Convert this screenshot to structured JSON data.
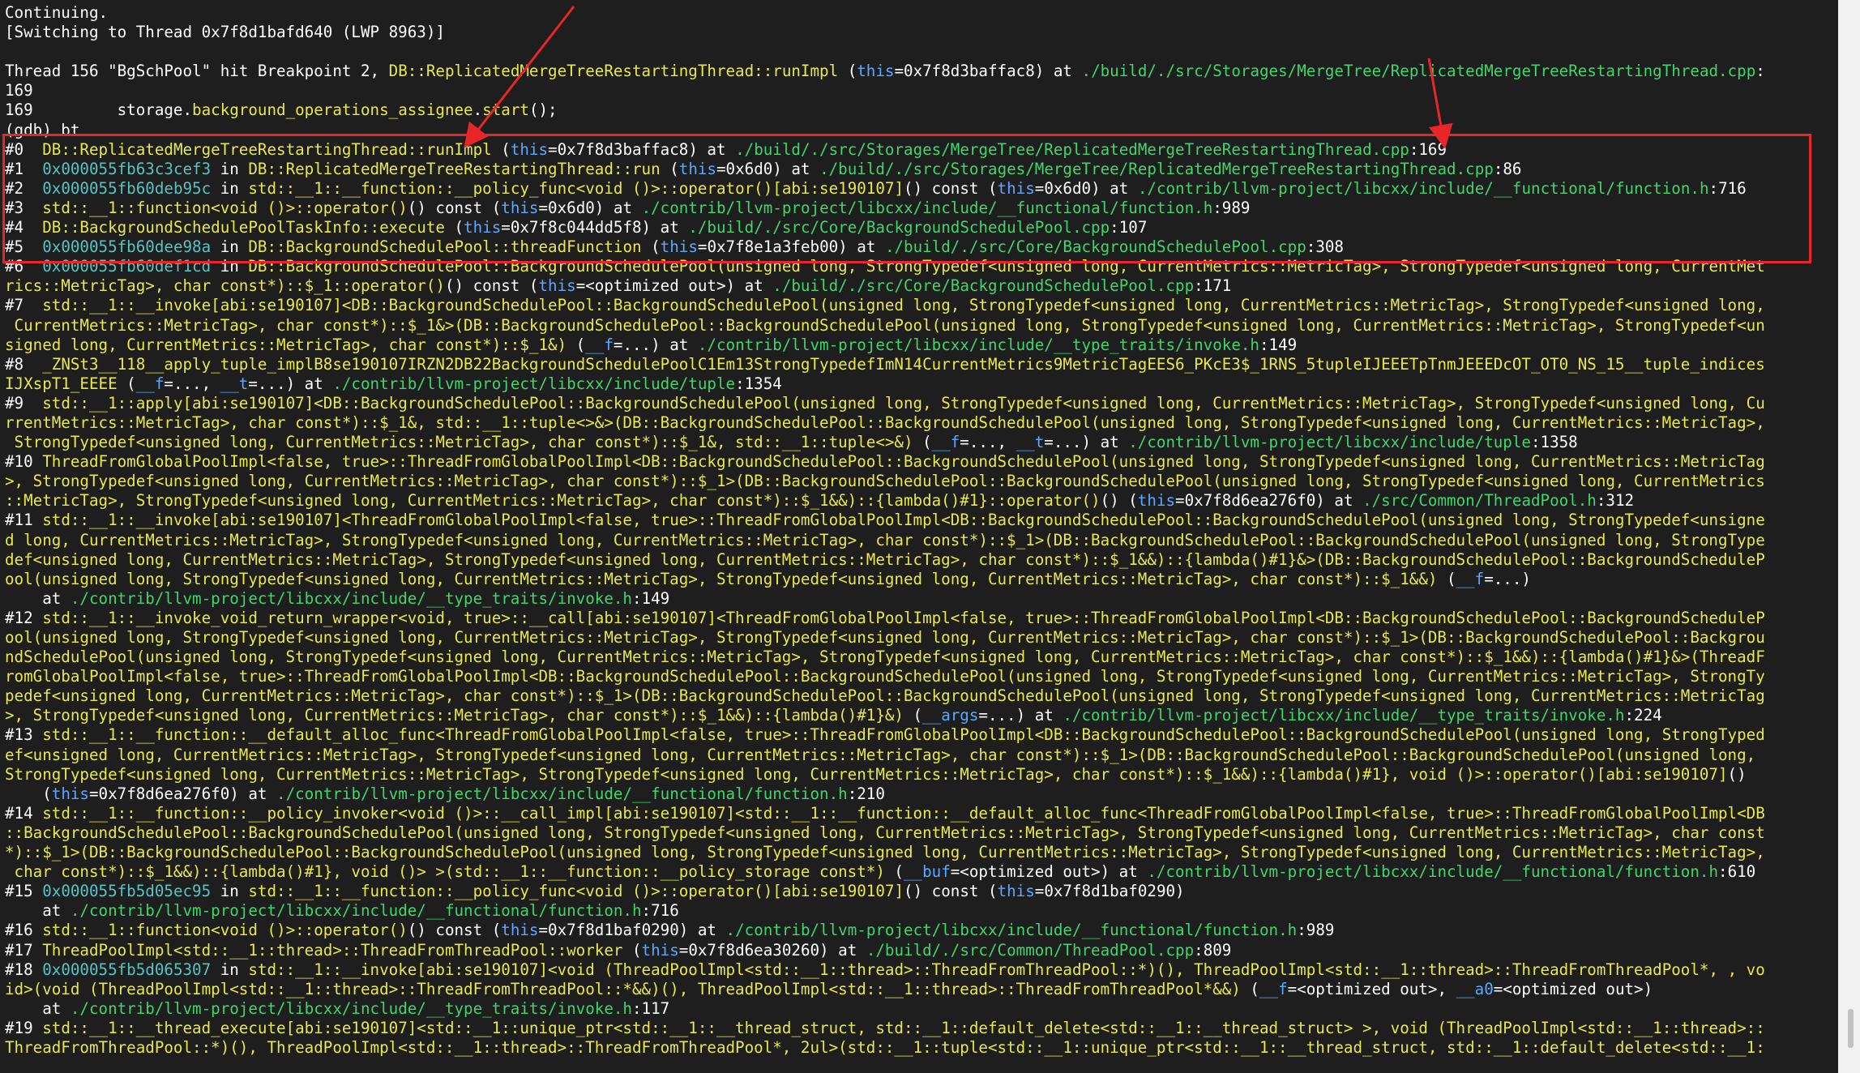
{
  "colors": {
    "background": "#1e1e1e",
    "highlight": "#e8262a",
    "text": "#ffffff",
    "function": "#e8e84a",
    "address": "#56c4c4",
    "path": "#3fd66b",
    "keyword": "#5aa8ff"
  },
  "lines": [
    [
      [
        "w",
        "Continuing."
      ]
    ],
    [
      [
        "w",
        "[Switching to Thread 0x7f8d1bafd640 (LWP 8963)]"
      ]
    ],
    [
      [
        "w",
        ""
      ]
    ],
    [
      [
        "w",
        "Thread 156 \"BgSchPool\" hit Breakpoint 2, "
      ],
      [
        "y",
        "DB::ReplicatedMergeTreeRestartingThread::runImpl"
      ],
      [
        "w",
        " ("
      ],
      [
        "b",
        "this"
      ],
      [
        "w",
        "=0x7f8d3baffac8) at "
      ],
      [
        "g",
        "./build/./src/Storages/MergeTree/ReplicatedMergeTreeRestartingThread.cpp"
      ],
      [
        "w",
        ":"
      ]
    ],
    [
      [
        "w",
        "169"
      ]
    ],
    [
      [
        "w",
        "169         storage."
      ],
      [
        "y",
        "background_operations_assignee"
      ],
      [
        "w",
        "."
      ],
      [
        "y",
        "start"
      ],
      [
        "w",
        "();"
      ]
    ],
    [
      [
        "w",
        "(gdb) bt"
      ]
    ],
    [
      [
        "w",
        "#0  "
      ],
      [
        "y",
        "DB::ReplicatedMergeTreeRestartingThread::runImpl"
      ],
      [
        "w",
        " ("
      ],
      [
        "b",
        "this"
      ],
      [
        "w",
        "=0x7f8d3baffac8) at "
      ],
      [
        "g",
        "./build/./src/Storages/MergeTree/ReplicatedMergeTreeRestartingThread.cpp"
      ],
      [
        "w",
        ":169"
      ]
    ],
    [
      [
        "w",
        "#1  "
      ],
      [
        "c",
        "0x000055fb63c3cef3"
      ],
      [
        "w",
        " in "
      ],
      [
        "y",
        "DB::ReplicatedMergeTreeRestartingThread::run"
      ],
      [
        "w",
        " ("
      ],
      [
        "b",
        "this"
      ],
      [
        "w",
        "=0x6d0) at "
      ],
      [
        "g",
        "./build/./src/Storages/MergeTree/ReplicatedMergeTreeRestartingThread.cpp"
      ],
      [
        "w",
        ":86"
      ]
    ],
    [
      [
        "w",
        "#2  "
      ],
      [
        "c",
        "0x000055fb60deb95c"
      ],
      [
        "w",
        " in "
      ],
      [
        "y",
        "std::__1::__function::__policy_func<void ()>::operator()[abi:se190107]"
      ],
      [
        "w",
        "() const ("
      ],
      [
        "b",
        "this"
      ],
      [
        "w",
        "=0x6d0) at "
      ],
      [
        "g",
        "./contrib/llvm-project/libcxx/include/__functional/function.h"
      ],
      [
        "w",
        ":716"
      ]
    ],
    [
      [
        "w",
        "#3  "
      ],
      [
        "y",
        "std::__1::function<void ()>::operator()"
      ],
      [
        "w",
        "() const ("
      ],
      [
        "b",
        "this"
      ],
      [
        "w",
        "=0x6d0) at "
      ],
      [
        "g",
        "./contrib/llvm-project/libcxx/include/__functional/function.h"
      ],
      [
        "w",
        ":989"
      ]
    ],
    [
      [
        "w",
        "#4  "
      ],
      [
        "y",
        "DB::BackgroundSchedulePoolTaskInfo::execute"
      ],
      [
        "w",
        " ("
      ],
      [
        "b",
        "this"
      ],
      [
        "w",
        "=0x7f8c044dd5f8) at "
      ],
      [
        "g",
        "./build/./src/Core/BackgroundSchedulePool.cpp"
      ],
      [
        "w",
        ":107"
      ]
    ],
    [
      [
        "w",
        "#5  "
      ],
      [
        "c",
        "0x000055fb60dee98a"
      ],
      [
        "w",
        " in "
      ],
      [
        "y",
        "DB::BackgroundSchedulePool::threadFunction"
      ],
      [
        "w",
        " ("
      ],
      [
        "b",
        "this"
      ],
      [
        "w",
        "=0x7f8e1a3feb00) at "
      ],
      [
        "g",
        "./build/./src/Core/BackgroundSchedulePool.cpp"
      ],
      [
        "w",
        ":308"
      ]
    ],
    [
      [
        "w",
        "#6  "
      ],
      [
        "c",
        "0x000055fb60def1cd"
      ],
      [
        "w",
        " in "
      ],
      [
        "y",
        "DB::BackgroundSchedulePool::BackgroundSchedulePool(unsigned long, StrongTypedef<unsigned long, CurrentMetrics::MetricTag>, StrongTypedef<unsigned long, CurrentMet"
      ]
    ],
    [
      [
        "y",
        "rics::MetricTag>, char const*)::$_1::operator()"
      ],
      [
        "w",
        "() const ("
      ],
      [
        "b",
        "this"
      ],
      [
        "w",
        "=<optimized out>) at "
      ],
      [
        "g",
        "./build/./src/Core/BackgroundSchedulePool.cpp"
      ],
      [
        "w",
        ":171"
      ]
    ],
    [
      [
        "w",
        "#7  "
      ],
      [
        "y",
        "std::__1::__invoke[abi:se190107]<DB::BackgroundSchedulePool::BackgroundSchedulePool(unsigned long, StrongTypedef<unsigned long, CurrentMetrics::MetricTag>, StrongTypedef<unsigned long,"
      ]
    ],
    [
      [
        "y",
        " CurrentMetrics::MetricTag>, char const*)::$_1&>(DB::BackgroundSchedulePool::BackgroundSchedulePool(unsigned long, StrongTypedef<unsigned long, CurrentMetrics::MetricTag>, StrongTypedef<un"
      ]
    ],
    [
      [
        "y",
        "signed long, CurrentMetrics::MetricTag>, char const*)::$_1&)"
      ],
      [
        "w",
        " ("
      ],
      [
        "b",
        "__f"
      ],
      [
        "w",
        "=...) at "
      ],
      [
        "g",
        "./contrib/llvm-project/libcxx/include/__type_traits/invoke.h"
      ],
      [
        "w",
        ":149"
      ]
    ],
    [
      [
        "w",
        "#8  "
      ],
      [
        "y",
        "_ZNSt3__118__apply_tuple_implB8se190107IRZN2DB22BackgroundSchedulePoolC1Em13StrongTypedefImN14CurrentMetrics9MetricTagEES6_PKcE3$_1RNS_5tupleIJEEETpTnmJEEEDcOT_OT0_NS_15__tuple_indices"
      ]
    ],
    [
      [
        "y",
        "IJXspT1_EEEE"
      ],
      [
        "w",
        " ("
      ],
      [
        "b",
        "__f"
      ],
      [
        "w",
        "=..., "
      ],
      [
        "b",
        "__t"
      ],
      [
        "w",
        "=...) at "
      ],
      [
        "g",
        "./contrib/llvm-project/libcxx/include/tuple"
      ],
      [
        "w",
        ":1354"
      ]
    ],
    [
      [
        "w",
        "#9  "
      ],
      [
        "y",
        "std::__1::apply[abi:se190107]<DB::BackgroundSchedulePool::BackgroundSchedulePool(unsigned long, StrongTypedef<unsigned long, CurrentMetrics::MetricTag>, StrongTypedef<unsigned long, Cu"
      ]
    ],
    [
      [
        "y",
        "rrentMetrics::MetricTag>, char const*)::$_1&, std::__1::tuple<>&>(DB::BackgroundSchedulePool::BackgroundSchedulePool(unsigned long, StrongTypedef<unsigned long, CurrentMetrics::MetricTag>,"
      ]
    ],
    [
      [
        "y",
        " StrongTypedef<unsigned long, CurrentMetrics::MetricTag>, char const*)::$_1&, std::__1::tuple<>&)"
      ],
      [
        "w",
        " ("
      ],
      [
        "b",
        "__f"
      ],
      [
        "w",
        "=..., "
      ],
      [
        "b",
        "__t"
      ],
      [
        "w",
        "=...) at "
      ],
      [
        "g",
        "./contrib/llvm-project/libcxx/include/tuple"
      ],
      [
        "w",
        ":1358"
      ]
    ],
    [
      [
        "w",
        "#10 "
      ],
      [
        "y",
        "ThreadFromGlobalPoolImpl<false, true>::ThreadFromGlobalPoolImpl<DB::BackgroundSchedulePool::BackgroundSchedulePool(unsigned long, StrongTypedef<unsigned long, CurrentMetrics::MetricTag"
      ]
    ],
    [
      [
        "y",
        ">, StrongTypedef<unsigned long, CurrentMetrics::MetricTag>, char const*)::$_1>(DB::BackgroundSchedulePool::BackgroundSchedulePool(unsigned long, StrongTypedef<unsigned long, CurrentMetrics"
      ]
    ],
    [
      [
        "y",
        "::MetricTag>, StrongTypedef<unsigned long, CurrentMetrics::MetricTag>, char const*)::$_1&&)::{lambda()#1}::operator()"
      ],
      [
        "w",
        "() ("
      ],
      [
        "b",
        "this"
      ],
      [
        "w",
        "=0x7f8d6ea276f0) at "
      ],
      [
        "g",
        "./src/Common/ThreadPool.h"
      ],
      [
        "w",
        ":312"
      ]
    ],
    [
      [
        "w",
        "#11 "
      ],
      [
        "y",
        "std::__1::__invoke[abi:se190107]<ThreadFromGlobalPoolImpl<false, true>::ThreadFromGlobalPoolImpl<DB::BackgroundSchedulePool::BackgroundSchedulePool(unsigned long, StrongTypedef<unsigne"
      ]
    ],
    [
      [
        "y",
        "d long, CurrentMetrics::MetricTag>, StrongTypedef<unsigned long, CurrentMetrics::MetricTag>, char const*)::$_1>(DB::BackgroundSchedulePool::BackgroundSchedulePool(unsigned long, StrongType"
      ]
    ],
    [
      [
        "y",
        "def<unsigned long, CurrentMetrics::MetricTag>, StrongTypedef<unsigned long, CurrentMetrics::MetricTag>, char const*)::$_1&&)::{lambda()#1}&>(DB::BackgroundSchedulePool::BackgroundScheduleP"
      ]
    ],
    [
      [
        "y",
        "ool(unsigned long, StrongTypedef<unsigned long, CurrentMetrics::MetricTag>, StrongTypedef<unsigned long, CurrentMetrics::MetricTag>, char const*)::$_1&&)"
      ],
      [
        "w",
        " ("
      ],
      [
        "b",
        "__f"
      ],
      [
        "w",
        "=...)"
      ]
    ],
    [
      [
        "w",
        "    at "
      ],
      [
        "g",
        "./contrib/llvm-project/libcxx/include/__type_traits/invoke.h"
      ],
      [
        "w",
        ":149"
      ]
    ],
    [
      [
        "w",
        "#12 "
      ],
      [
        "y",
        "std::__1::__invoke_void_return_wrapper<void, true>::__call[abi:se190107]<ThreadFromGlobalPoolImpl<false, true>::ThreadFromGlobalPoolImpl<DB::BackgroundSchedulePool::BackgroundScheduleP"
      ]
    ],
    [
      [
        "y",
        "ool(unsigned long, StrongTypedef<unsigned long, CurrentMetrics::MetricTag>, StrongTypedef<unsigned long, CurrentMetrics::MetricTag>, char const*)::$_1>(DB::BackgroundSchedulePool::Backgrou"
      ]
    ],
    [
      [
        "y",
        "ndSchedulePool(unsigned long, StrongTypedef<unsigned long, CurrentMetrics::MetricTag>, StrongTypedef<unsigned long, CurrentMetrics::MetricTag>, char const*)::$_1&&)::{lambda()#1}&>(ThreadF"
      ]
    ],
    [
      [
        "y",
        "romGlobalPoolImpl<false, true>::ThreadFromGlobalPoolImpl<DB::BackgroundSchedulePool::BackgroundSchedulePool(unsigned long, StrongTypedef<unsigned long, CurrentMetrics::MetricTag>, StrongTy"
      ]
    ],
    [
      [
        "y",
        "pedef<unsigned long, CurrentMetrics::MetricTag>, char const*)::$_1>(DB::BackgroundSchedulePool::BackgroundSchedulePool(unsigned long, StrongTypedef<unsigned long, CurrentMetrics::MetricTag"
      ]
    ],
    [
      [
        "y",
        ">, StrongTypedef<unsigned long, CurrentMetrics::MetricTag>, char const*)::$_1&&)::{lambda()#1}&)"
      ],
      [
        "w",
        " ("
      ],
      [
        "b",
        "__args"
      ],
      [
        "w",
        "=...) at "
      ],
      [
        "g",
        "./contrib/llvm-project/libcxx/include/__type_traits/invoke.h"
      ],
      [
        "w",
        ":224"
      ]
    ],
    [
      [
        "w",
        "#13 "
      ],
      [
        "y",
        "std::__1::__function::__default_alloc_func<ThreadFromGlobalPoolImpl<false, true>::ThreadFromGlobalPoolImpl<DB::BackgroundSchedulePool::BackgroundSchedulePool(unsigned long, StrongTyped"
      ]
    ],
    [
      [
        "y",
        "ef<unsigned long, CurrentMetrics::MetricTag>, StrongTypedef<unsigned long, CurrentMetrics::MetricTag>, char const*)::$_1>(DB::BackgroundSchedulePool::BackgroundSchedulePool(unsigned long,"
      ]
    ],
    [
      [
        "y",
        "StrongTypedef<unsigned long, CurrentMetrics::MetricTag>, StrongTypedef<unsigned long, CurrentMetrics::MetricTag>, char const*)::$_1&&)::{lambda()#1}, void ()>::operator()[abi:se190107]"
      ],
      [
        "w",
        "()"
      ]
    ],
    [
      [
        "w",
        "    ("
      ],
      [
        "b",
        "this"
      ],
      [
        "w",
        "=0x7f8d6ea276f0) at "
      ],
      [
        "g",
        "./contrib/llvm-project/libcxx/include/__functional/function.h"
      ],
      [
        "w",
        ":210"
      ]
    ],
    [
      [
        "w",
        "#14 "
      ],
      [
        "y",
        "std::__1::__function::__policy_invoker<void ()>::__call_impl[abi:se190107]<std::__1::__function::__default_alloc_func<ThreadFromGlobalPoolImpl<false, true>::ThreadFromGlobalPoolImpl<DB"
      ]
    ],
    [
      [
        "y",
        "::BackgroundSchedulePool::BackgroundSchedulePool(unsigned long, StrongTypedef<unsigned long, CurrentMetrics::MetricTag>, StrongTypedef<unsigned long, CurrentMetrics::MetricTag>, char const"
      ]
    ],
    [
      [
        "y",
        "*)::$_1>(DB::BackgroundSchedulePool::BackgroundSchedulePool(unsigned long, StrongTypedef<unsigned long, CurrentMetrics::MetricTag>, StrongTypedef<unsigned long, CurrentMetrics::MetricTag>,"
      ]
    ],
    [
      [
        "y",
        " char const*)::$_1&&)::{lambda()#1}, void ()> >(std::__1::__function::__policy_storage const*)"
      ],
      [
        "w",
        " ("
      ],
      [
        "b",
        "__buf"
      ],
      [
        "w",
        "=<optimized out>) at "
      ],
      [
        "g",
        "./contrib/llvm-project/libcxx/include/__functional/function.h"
      ],
      [
        "w",
        ":610"
      ]
    ],
    [
      [
        "w",
        "#15 "
      ],
      [
        "c",
        "0x000055fb5d05ec95"
      ],
      [
        "w",
        " in "
      ],
      [
        "y",
        "std::__1::__function::__policy_func<void ()>::operator()[abi:se190107]"
      ],
      [
        "w",
        "() const ("
      ],
      [
        "b",
        "this"
      ],
      [
        "w",
        "=0x7f8d1baf0290)"
      ]
    ],
    [
      [
        "w",
        "    at "
      ],
      [
        "g",
        "./contrib/llvm-project/libcxx/include/__functional/function.h"
      ],
      [
        "w",
        ":716"
      ]
    ],
    [
      [
        "w",
        "#16 "
      ],
      [
        "y",
        "std::__1::function<void ()>::operator()"
      ],
      [
        "w",
        "() const ("
      ],
      [
        "b",
        "this"
      ],
      [
        "w",
        "=0x7f8d1baf0290) at "
      ],
      [
        "g",
        "./contrib/llvm-project/libcxx/include/__functional/function.h"
      ],
      [
        "w",
        ":989"
      ]
    ],
    [
      [
        "w",
        "#17 "
      ],
      [
        "y",
        "ThreadPoolImpl<std::__1::thread>::ThreadFromThreadPool::worker"
      ],
      [
        "w",
        " ("
      ],
      [
        "b",
        "this"
      ],
      [
        "w",
        "=0x7f8d6ea30260) at "
      ],
      [
        "g",
        "./build/./src/Common/ThreadPool.cpp"
      ],
      [
        "w",
        ":809"
      ]
    ],
    [
      [
        "w",
        "#18 "
      ],
      [
        "c",
        "0x000055fb5d065307"
      ],
      [
        "w",
        " in "
      ],
      [
        "y",
        "std::__1::__invoke[abi:se190107]<void (ThreadPoolImpl<std::__1::thread>::ThreadFromThreadPool::*)(), ThreadPoolImpl<std::__1::thread>::ThreadFromThreadPool*, , vo"
      ]
    ],
    [
      [
        "y",
        "id>(void (ThreadPoolImpl<std::__1::thread>::ThreadFromThreadPool::*&&)(), ThreadPoolImpl<std::__1::thread>::ThreadFromThreadPool*&&)"
      ],
      [
        "w",
        " ("
      ],
      [
        "b",
        "__f"
      ],
      [
        "w",
        "=<optimized out>, "
      ],
      [
        "b",
        "__a0"
      ],
      [
        "w",
        "=<optimized out>)"
      ]
    ],
    [
      [
        "w",
        "    at "
      ],
      [
        "g",
        "./contrib/llvm-project/libcxx/include/__type_traits/invoke.h"
      ],
      [
        "w",
        ":117"
      ]
    ],
    [
      [
        "w",
        "#19 "
      ],
      [
        "y",
        "std::__1::__thread_execute[abi:se190107]<std::__1::unique_ptr<std::__1::__thread_struct, std::__1::default_delete<std::__1::__thread_struct> >, void (ThreadPoolImpl<std::__1::thread>::"
      ]
    ],
    [
      [
        "y",
        "ThreadFromThreadPool::*)(), ThreadPoolImpl<std::__1::thread>::ThreadFromThreadPool*, 2ul>(std::__1::tuple<std::__1::unique_ptr<std::__1::__thread_struct, std::__1::default_delete<std::__1:"
      ]
    ]
  ]
}
